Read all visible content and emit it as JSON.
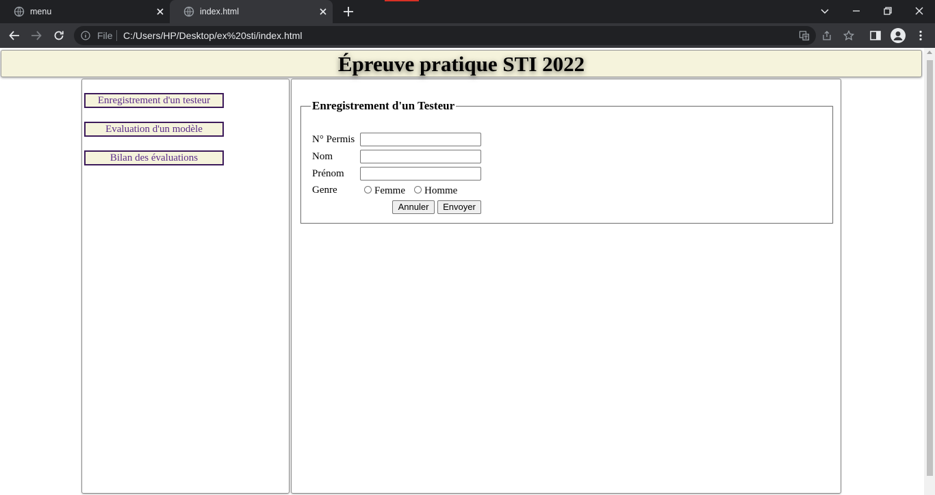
{
  "browser": {
    "tabs": [
      {
        "title": "menu",
        "active": false
      },
      {
        "title": "index.html",
        "active": true
      }
    ],
    "address": {
      "scheme_label": "File",
      "url": "C:/Users/HP/Desktop/ex%20sti/index.html"
    }
  },
  "page": {
    "title": "Épreuve pratique STI 2022",
    "menu": [
      {
        "label": "Enregistrement d'un testeur"
      },
      {
        "label": "Evaluation d'un modèle"
      },
      {
        "label": "Bilan des évaluations"
      }
    ],
    "form": {
      "legend": "Enregistrement d'un Testeur",
      "fields": {
        "permis_label": "N° Permis",
        "nom_label": "Nom",
        "prenom_label": "Prénom",
        "genre_label": "Genre",
        "genre_options": [
          "Femme",
          "Homme"
        ]
      },
      "buttons": {
        "reset": "Annuler",
        "submit": "Envoyer"
      }
    }
  },
  "colors": {
    "chrome_dark": "#202124",
    "chrome_bar": "#35363a",
    "banner_bg": "#f5f3dc",
    "menu_text": "#5b2b8a",
    "menu_border": "#3c1a5a"
  }
}
